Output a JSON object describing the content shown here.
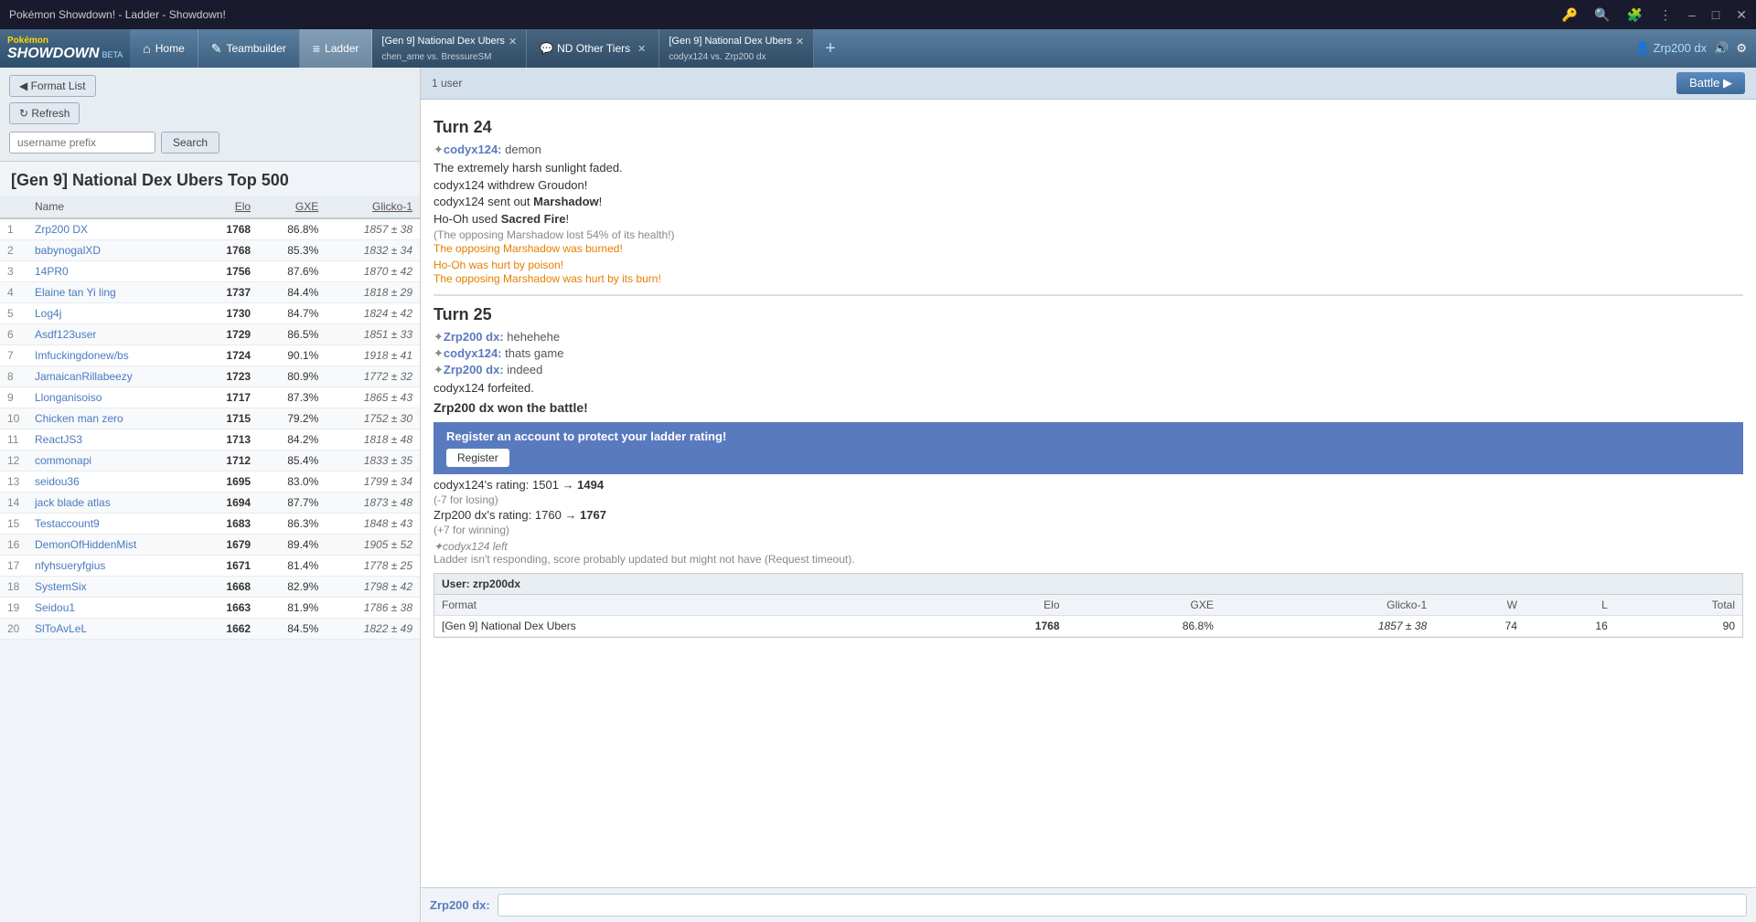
{
  "titlebar": {
    "title": "Pokémon Showdown! - Ladder - Showdown!",
    "icons": [
      "key",
      "search",
      "puzzle",
      "dots",
      "minimize",
      "maximize",
      "close"
    ]
  },
  "tabbar": {
    "logo": {
      "pokemon": "Pokémon",
      "showdown": "SHOWDOWN",
      "beta": "BETA"
    },
    "tabs": [
      {
        "id": "home",
        "icon": "⌂",
        "label": "Home"
      },
      {
        "id": "teambuilder",
        "icon": "✎",
        "label": "Teambuilder"
      },
      {
        "id": "ladder",
        "icon": "≡",
        "label": "Ladder"
      },
      {
        "id": "battle1",
        "label": "[Gen 9] National Dex Ubers",
        "sublabel": "chen_ame vs. BressureSM",
        "closeable": true
      },
      {
        "id": "battle2-chat",
        "icon": "💬",
        "label": "ND Other Tiers",
        "closeable": true
      },
      {
        "id": "battle2",
        "label": "[Gen 9] National Dex Ubers",
        "sublabel": "codyx124 vs. Zrp200 dx",
        "closeable": true
      }
    ],
    "add_btn": "+",
    "user": "Zrp200 dx",
    "volume_icon": "🔊",
    "settings_icon": "⚙"
  },
  "ladder": {
    "format_list_btn": "◀ Format List",
    "refresh_btn": "↻ Refresh",
    "search_placeholder": "username prefix",
    "search_btn": "Search",
    "title": "[Gen 9] National Dex Ubers Top 500",
    "columns": [
      "",
      "Name",
      "Elo",
      "GXE",
      "Glicko-1"
    ],
    "rows": [
      {
        "rank": 1,
        "name": "Zrp200 DX",
        "elo": "1768",
        "gxe": "86.8%",
        "glicko": "1857 ± 38"
      },
      {
        "rank": 2,
        "name": "babynogalXD",
        "elo": "1768",
        "gxe": "85.3%",
        "glicko": "1832 ± 34"
      },
      {
        "rank": 3,
        "name": "14PR0",
        "elo": "1756",
        "gxe": "87.6%",
        "glicko": "1870 ± 42"
      },
      {
        "rank": 4,
        "name": "Elaine tan Yi ling",
        "elo": "1737",
        "gxe": "84.4%",
        "glicko": "1818 ± 29"
      },
      {
        "rank": 5,
        "name": "Log4j",
        "elo": "1730",
        "gxe": "84.7%",
        "glicko": "1824 ± 42"
      },
      {
        "rank": 6,
        "name": "Asdf123user",
        "elo": "1729",
        "gxe": "86.5%",
        "glicko": "1851 ± 33"
      },
      {
        "rank": 7,
        "name": "Imfuckingdonew/bs",
        "elo": "1724",
        "gxe": "90.1%",
        "glicko": "1918 ± 41"
      },
      {
        "rank": 8,
        "name": "JamaicanRillabeezy",
        "elo": "1723",
        "gxe": "80.9%",
        "glicko": "1772 ± 32"
      },
      {
        "rank": 9,
        "name": "Llonganisoiso",
        "elo": "1717",
        "gxe": "87.3%",
        "glicko": "1865 ± 43"
      },
      {
        "rank": 10,
        "name": "Chicken man zero",
        "elo": "1715",
        "gxe": "79.2%",
        "glicko": "1752 ± 30"
      },
      {
        "rank": 11,
        "name": "ReactJS3",
        "elo": "1713",
        "gxe": "84.2%",
        "glicko": "1818 ± 48"
      },
      {
        "rank": 12,
        "name": "commonapi",
        "elo": "1712",
        "gxe": "85.4%",
        "glicko": "1833 ± 35"
      },
      {
        "rank": 13,
        "name": "seidou36",
        "elo": "1695",
        "gxe": "83.0%",
        "glicko": "1799 ± 34"
      },
      {
        "rank": 14,
        "name": "jack blade atlas",
        "elo": "1694",
        "gxe": "87.7%",
        "glicko": "1873 ± 48"
      },
      {
        "rank": 15,
        "name": "Testaccount9",
        "elo": "1683",
        "gxe": "86.3%",
        "glicko": "1848 ± 43"
      },
      {
        "rank": 16,
        "name": "DemonOfHiddenMist",
        "elo": "1679",
        "gxe": "89.4%",
        "glicko": "1905 ± 52"
      },
      {
        "rank": 17,
        "name": "nfyhsueryfgius",
        "elo": "1671",
        "gxe": "81.4%",
        "glicko": "1778 ± 25"
      },
      {
        "rank": 18,
        "name": "SystemSix",
        "elo": "1668",
        "gxe": "82.9%",
        "glicko": "1798 ± 42"
      },
      {
        "rank": 19,
        "name": "Seidou1",
        "elo": "1663",
        "gxe": "81.9%",
        "glicko": "1786 ± 38"
      },
      {
        "rank": 20,
        "name": "SlToAvLeL",
        "elo": "1662",
        "gxe": "84.5%",
        "glicko": "1822 ± 49"
      }
    ]
  },
  "battle": {
    "user_count": "1 user",
    "battle_btn": "Battle ▶",
    "turn24": {
      "header": "Turn 24",
      "lines": [
        {
          "type": "chat",
          "user": "codyx124",
          "symbol": "✦",
          "msg": "demon"
        },
        {
          "type": "blank"
        },
        {
          "type": "action",
          "text": "The extremely harsh sunlight faded."
        },
        {
          "type": "blank"
        },
        {
          "type": "action",
          "text": "codyx124 withdrew Groudon!"
        },
        {
          "type": "action",
          "html": "codyx124 sent out <strong>Marshadow</strong>!"
        },
        {
          "type": "blank"
        },
        {
          "type": "action",
          "html": "Ho-Oh used <strong>Sacred Fire</strong>!"
        },
        {
          "type": "minor",
          "text": "(The opposing Marshadow lost 54% of its health!)"
        },
        {
          "type": "status",
          "text": "The opposing Marshadow was burned!"
        },
        {
          "type": "blank"
        },
        {
          "type": "status",
          "text": "Ho-Oh was hurt by poison!"
        },
        {
          "type": "status",
          "text": "The opposing Marshadow was hurt by its burn!"
        }
      ]
    },
    "turn25": {
      "header": "Turn 25",
      "lines": [
        {
          "type": "chat",
          "user": "Zrp200 dx",
          "symbol": "✦",
          "msg": "hehehehe",
          "color": "blue"
        },
        {
          "type": "chat",
          "user": "codyx124",
          "symbol": "✦",
          "msg": "thats game"
        },
        {
          "type": "chat",
          "user": "Zrp200 dx",
          "symbol": "✦",
          "msg": "indeed",
          "color": "blue"
        },
        {
          "type": "blank"
        },
        {
          "type": "action",
          "text": "codyx124 forfeited."
        },
        {
          "type": "blank"
        },
        {
          "type": "win",
          "text": "Zrp200 dx won the battle!"
        }
      ]
    },
    "register_banner": {
      "text": "Register an account to protect your ladder rating!",
      "btn": "Register"
    },
    "ratings": [
      {
        "user": "codyx124",
        "old": "1501",
        "new": "1494",
        "change": "-7 for losing"
      },
      {
        "user": "Zrp200 dx",
        "old": "1760",
        "new": "1767",
        "change": "+7 for winning"
      }
    ],
    "user_left": "✦codyx124 left",
    "timeout_msg": "Ladder isn't responding, score probably updated but might not have (Request timeout).",
    "stats_box": {
      "user_label": "User: zrp200dx",
      "columns": [
        "Format",
        "Elo",
        "GXE",
        "Glicko-1",
        "W",
        "L",
        "Total"
      ],
      "row": {
        "format": "[Gen 9] National Dex Ubers",
        "elo": "1768",
        "gxe": "86.8%",
        "glicko": "1857 ± 38",
        "w": "74",
        "l": "16",
        "total": "90"
      }
    },
    "chat_input_user": "Zrp200 dx:",
    "chat_input_placeholder": ""
  }
}
